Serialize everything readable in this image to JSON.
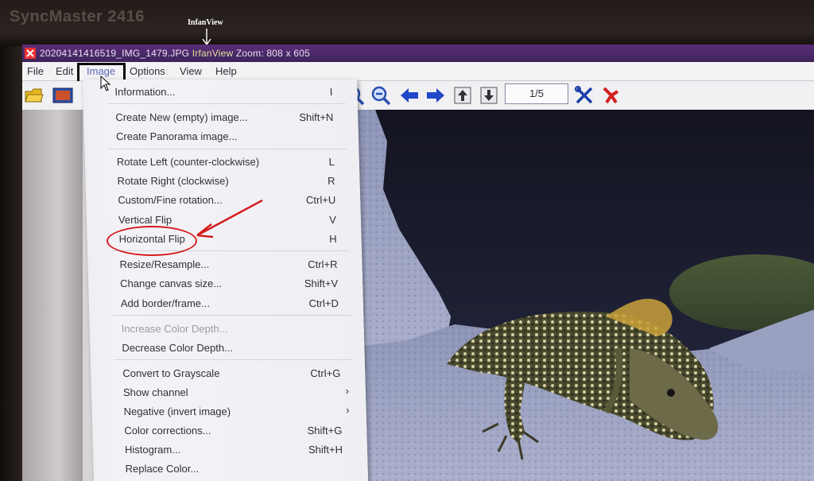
{
  "monitor": {
    "brand": "SyncMaster 2416"
  },
  "annotation": {
    "label": "InfanView"
  },
  "window": {
    "title_prefix": "20204141416519_IMG_1479.JPG ",
    "title_app": "IrfanView",
    "title_suffix": " Zoom: 808 x 605"
  },
  "menubar": {
    "items": [
      "File",
      "Edit",
      "Image",
      "Options",
      "View",
      "Help"
    ]
  },
  "toolbar": {
    "page_counter": "1/5"
  },
  "dropdown": {
    "items": [
      {
        "label": "Information...",
        "shortcut": "I"
      },
      {
        "label": "Create New (empty) image...",
        "shortcut": "Shift+N"
      },
      {
        "label": "Create Panorama image...",
        "shortcut": ""
      },
      {
        "label": "Rotate Left (counter-clockwise)",
        "shortcut": "L"
      },
      {
        "label": "Rotate Right (clockwise)",
        "shortcut": "R"
      },
      {
        "label": "Custom/Fine rotation...",
        "shortcut": "Ctrl+U"
      },
      {
        "label": "Vertical Flip",
        "shortcut": "V"
      },
      {
        "label": "Horizontal Flip",
        "shortcut": "H"
      },
      {
        "label": "Resize/Resample...",
        "shortcut": "Ctrl+R"
      },
      {
        "label": "Change canvas size...",
        "shortcut": "Shift+V"
      },
      {
        "label": "Add border/frame...",
        "shortcut": "Ctrl+D"
      },
      {
        "label": "Increase Color Depth...",
        "shortcut": ""
      },
      {
        "label": "Decrease Color Depth...",
        "shortcut": ""
      },
      {
        "label": "Convert to Grayscale",
        "shortcut": "Ctrl+G"
      },
      {
        "label": "Show channel",
        "shortcut": ""
      },
      {
        "label": "Negative (invert image)",
        "shortcut": ""
      },
      {
        "label": "Color corrections...",
        "shortcut": "Shift+G"
      },
      {
        "label": "Histogram...",
        "shortcut": "Shift+H"
      },
      {
        "label": "Replace Color...",
        "shortcut": ""
      }
    ]
  },
  "colors": {
    "titlebar": "#4a2868",
    "menu_highlight": "#5f63b9",
    "annotation_yellow": "#e8d40e",
    "annotation_red": "#d51c1c"
  }
}
